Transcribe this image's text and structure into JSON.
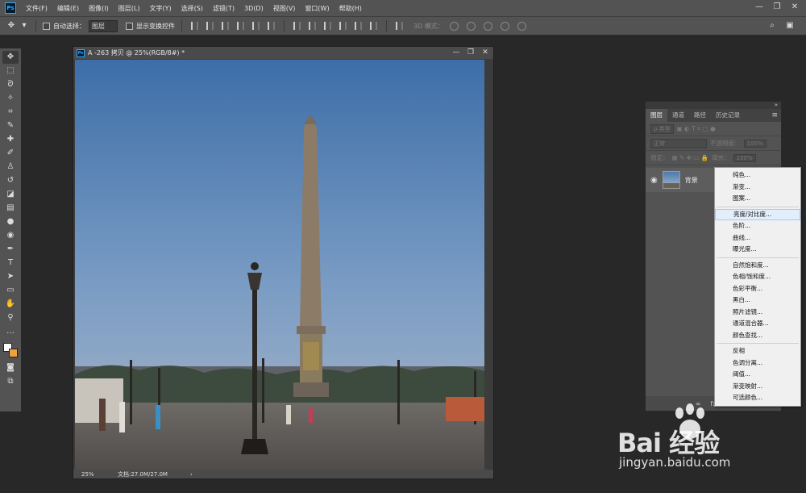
{
  "app": {
    "logo": "Ps"
  },
  "menubar": {
    "items": [
      "文件(F)",
      "编辑(E)",
      "图像(I)",
      "图层(L)",
      "文字(Y)",
      "选择(S)",
      "滤镜(T)",
      "3D(D)",
      "视图(V)",
      "窗口(W)",
      "帮助(H)"
    ],
    "window_controls": [
      "—",
      "❐",
      "✕"
    ]
  },
  "options": {
    "auto_select_label": "自动选择：",
    "auto_select_value": "图层",
    "show_transform_label": "显示变换控件",
    "mode_3d_label": "3D 模式："
  },
  "document": {
    "title": "A -263 拷贝 @ 25%(RGB/8#) *",
    "zoom": "25%",
    "info": "文档:27.0M/27.0M"
  },
  "layers_panel": {
    "collapse": "»",
    "tabs": [
      "图层",
      "通道",
      "路径",
      "历史记录"
    ],
    "filter_kind": "ρ 类型",
    "blend_mode": "正常",
    "opacity_label": "不透明度：",
    "opacity_value": "100%",
    "lock_label": "锁定：",
    "fill_label": "填充：",
    "fill_value": "100%",
    "layer_name": "背景",
    "footer_icons": [
      "∞",
      "fx",
      "◘"
    ]
  },
  "context_menu": {
    "groups": [
      [
        "纯色...",
        "渐变...",
        "图案..."
      ],
      [
        "亮度/对比度...",
        "色阶...",
        "曲线...",
        "曝光度..."
      ],
      [
        "自然饱和度...",
        "色相/饱和度...",
        "色彩平衡...",
        "黑白...",
        "照片滤镜...",
        "通道混合器...",
        "颜色查找..."
      ],
      [
        "反相",
        "色调分离...",
        "阈值...",
        "渐变映射...",
        "可选颜色..."
      ]
    ],
    "highlighted": "亮度/对比度..."
  },
  "watermark": {
    "logo": "Bai   经验",
    "url": "jingyan.baidu.com"
  },
  "colors": {
    "menubar_bg": "#535353",
    "workspace_bg": "#282828",
    "bg_swatch": "#f2a13a",
    "highlight": "#e3eefb"
  }
}
